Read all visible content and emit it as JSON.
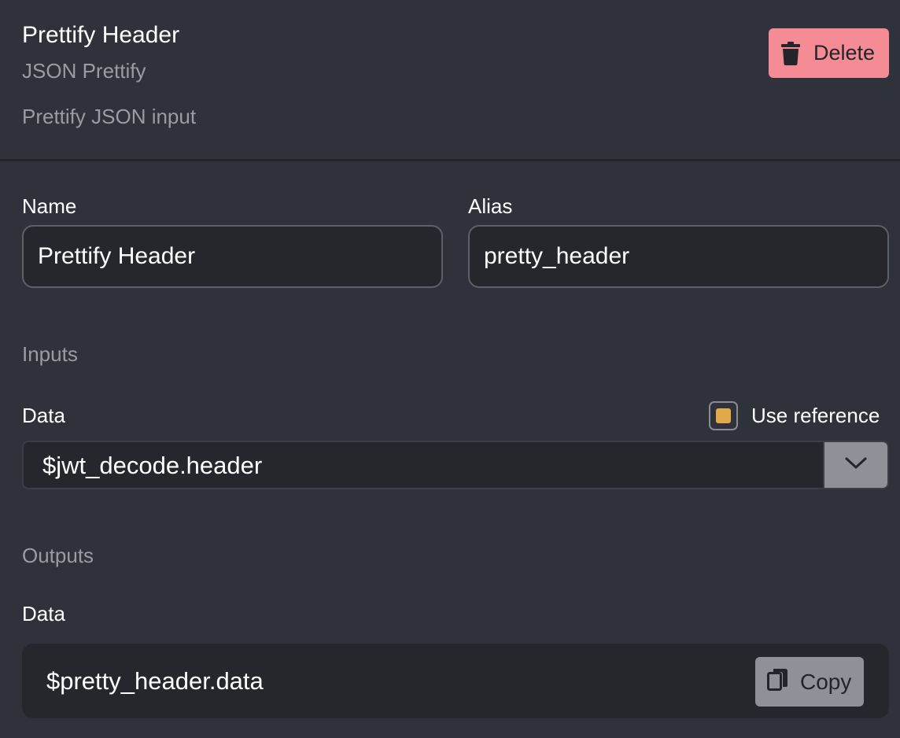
{
  "header": {
    "title": "Prettify Header",
    "subtitle": "JSON Prettify",
    "description": "Prettify JSON input",
    "delete_label": "Delete"
  },
  "fields": {
    "name_label": "Name",
    "name_value": "Prettify Header",
    "alias_label": "Alias",
    "alias_value": "pretty_header"
  },
  "inputs": {
    "section_label": "Inputs",
    "data_label": "Data",
    "use_reference_label": "Use reference",
    "use_reference_checked": true,
    "data_value": "$jwt_decode.header"
  },
  "outputs": {
    "section_label": "Outputs",
    "data_label": "Data",
    "data_value": "$pretty_header.data",
    "copy_label": "Copy"
  },
  "colors": {
    "background": "#2f323b",
    "field_background": "#25272d",
    "delete_button": "#f58b95",
    "checkbox_accent": "#e1a94a",
    "muted_text": "#9a9ca3"
  },
  "icons": {
    "delete": "trash-icon",
    "dropdown": "chevron-down-icon",
    "copy": "copy-icon"
  }
}
